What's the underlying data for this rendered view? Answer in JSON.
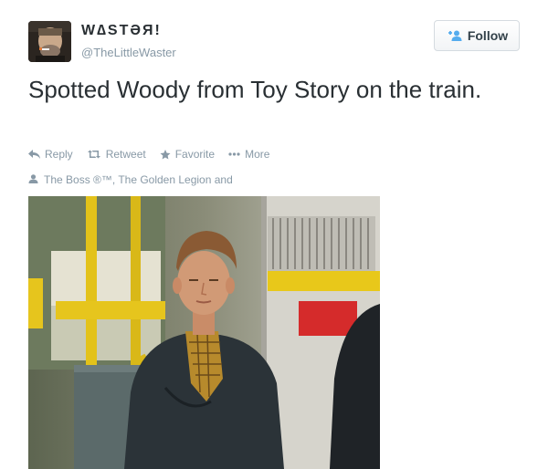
{
  "user": {
    "display_name": "W∆STƏЯ!",
    "handle": "@TheLittleWaster"
  },
  "follow_button": {
    "label": "Follow"
  },
  "tweet": {
    "text": "Spotted Woody from Toy Story on the train."
  },
  "actions": {
    "reply": "Reply",
    "retweet": "Retweet",
    "favorite": "Favorite",
    "more": "More"
  },
  "social_context": {
    "text": "The Boss ®™, The Golden Legion and"
  },
  "colors": {
    "text_primary": "#292f33",
    "text_muted": "#8899a6",
    "accent": "#55acee"
  },
  "icons": {
    "follow": "add-user-icon",
    "reply": "reply-icon",
    "retweet": "retweet-icon",
    "favorite": "star-icon",
    "more": "more-dots-icon",
    "social": "person-icon"
  }
}
